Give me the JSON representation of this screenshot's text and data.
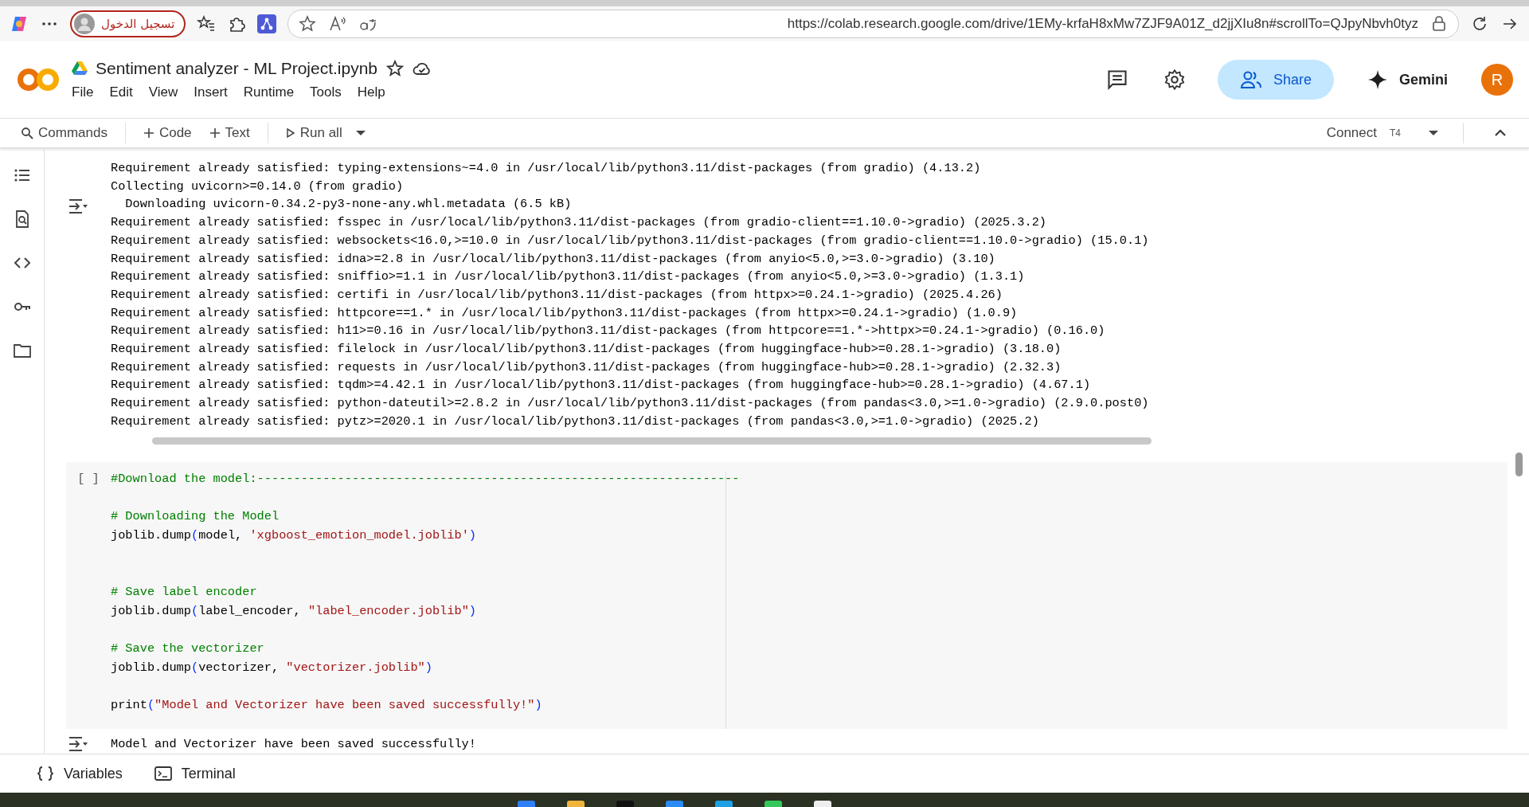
{
  "browser": {
    "signin": "تسجيل الدخول",
    "url": "https://colab.research.google.com/drive/1EMy-krfaH8xMw7ZJF9A01Z_d2jjXIu8n#scrollTo=QJpyNbvh0tyz"
  },
  "notebook": {
    "title": "Sentiment analyzer - ML Project.ipynb",
    "menu": [
      "File",
      "Edit",
      "View",
      "Insert",
      "Runtime",
      "Tools",
      "Help"
    ],
    "share": "Share",
    "gemini": "Gemini",
    "avatar": "R"
  },
  "toolbar": {
    "commands": "Commands",
    "add_code": "Code",
    "add_text": "Text",
    "run_all": "Run all",
    "connect": "Connect",
    "runtime": "T4"
  },
  "output_lines": [
    "Requirement already satisfied: typing-extensions~=4.0 in /usr/local/lib/python3.11/dist-packages (from gradio) (4.13.2)",
    "Collecting uvicorn>=0.14.0 (from gradio)",
    "  Downloading uvicorn-0.34.2-py3-none-any.whl.metadata (6.5 kB)",
    "Requirement already satisfied: fsspec in /usr/local/lib/python3.11/dist-packages (from gradio-client==1.10.0->gradio) (2025.3.2)",
    "Requirement already satisfied: websockets<16.0,>=10.0 in /usr/local/lib/python3.11/dist-packages (from gradio-client==1.10.0->gradio) (15.0.1)",
    "Requirement already satisfied: idna>=2.8 in /usr/local/lib/python3.11/dist-packages (from anyio<5.0,>=3.0->gradio) (3.10)",
    "Requirement already satisfied: sniffio>=1.1 in /usr/local/lib/python3.11/dist-packages (from anyio<5.0,>=3.0->gradio) (1.3.1)",
    "Requirement already satisfied: certifi in /usr/local/lib/python3.11/dist-packages (from httpx>=0.24.1->gradio) (2025.4.26)",
    "Requirement already satisfied: httpcore==1.* in /usr/local/lib/python3.11/dist-packages (from httpx>=0.24.1->gradio) (1.0.9)",
    "Requirement already satisfied: h11>=0.16 in /usr/local/lib/python3.11/dist-packages (from httpcore==1.*->httpx>=0.24.1->gradio) (0.16.0)",
    "Requirement already satisfied: filelock in /usr/local/lib/python3.11/dist-packages (from huggingface-hub>=0.28.1->gradio) (3.18.0)",
    "Requirement already satisfied: requests in /usr/local/lib/python3.11/dist-packages (from huggingface-hub>=0.28.1->gradio) (2.32.3)",
    "Requirement already satisfied: tqdm>=4.42.1 in /usr/local/lib/python3.11/dist-packages (from huggingface-hub>=0.28.1->gradio) (4.67.1)",
    "Requirement already satisfied: python-dateutil>=2.8.2 in /usr/local/lib/python3.11/dist-packages (from pandas<3.0,>=1.0->gradio) (2.9.0.post0)",
    "Requirement already satisfied: pytz>=2020.1 in /usr/local/lib/python3.11/dist-packages (from pandas<3.0,>=1.0->gradio) (2025.2)"
  ],
  "code_cell": {
    "exec_count": "[ ]",
    "lines": [
      {
        "kind": "code",
        "segments": [
          {
            "kind": "comment",
            "text": "#Download the model:------------------------------------------------------------------"
          }
        ]
      },
      {
        "kind": "blank"
      },
      {
        "kind": "code",
        "segments": [
          {
            "kind": "comment",
            "text": "# Downloading the Model"
          }
        ]
      },
      {
        "kind": "code",
        "segments": [
          {
            "kind": "plain",
            "text": "joblib.dump"
          },
          {
            "kind": "paren",
            "text": "("
          },
          {
            "kind": "plain",
            "text": "model, "
          },
          {
            "kind": "string",
            "text": "'xgboost_emotion_model.joblib'"
          },
          {
            "kind": "paren",
            "text": ")"
          }
        ]
      },
      {
        "kind": "blank"
      },
      {
        "kind": "blank"
      },
      {
        "kind": "code",
        "segments": [
          {
            "kind": "comment",
            "text": "# Save label encoder"
          }
        ]
      },
      {
        "kind": "code",
        "segments": [
          {
            "kind": "plain",
            "text": "joblib.dump"
          },
          {
            "kind": "paren",
            "text": "("
          },
          {
            "kind": "plain",
            "text": "label_encoder, "
          },
          {
            "kind": "string",
            "text": "\"label_encoder.joblib\""
          },
          {
            "kind": "paren",
            "text": ")"
          }
        ]
      },
      {
        "kind": "blank"
      },
      {
        "kind": "code",
        "segments": [
          {
            "kind": "comment",
            "text": "# Save the vectorizer"
          }
        ]
      },
      {
        "kind": "code",
        "segments": [
          {
            "kind": "plain",
            "text": "joblib.dump"
          },
          {
            "kind": "paren",
            "text": "("
          },
          {
            "kind": "plain",
            "text": "vectorizer, "
          },
          {
            "kind": "string",
            "text": "\"vectorizer.joblib\""
          },
          {
            "kind": "paren",
            "text": ")"
          }
        ]
      },
      {
        "kind": "blank"
      },
      {
        "kind": "code",
        "segments": [
          {
            "kind": "plain",
            "text": "print"
          },
          {
            "kind": "paren",
            "text": "("
          },
          {
            "kind": "string",
            "text": "\"Model and Vectorizer have been saved successfully!\""
          },
          {
            "kind": "paren",
            "text": ")"
          }
        ]
      }
    ],
    "output": "Model and Vectorizer have been saved successfully!"
  },
  "bottom_tabs": [
    "Variables",
    "Terminal"
  ]
}
